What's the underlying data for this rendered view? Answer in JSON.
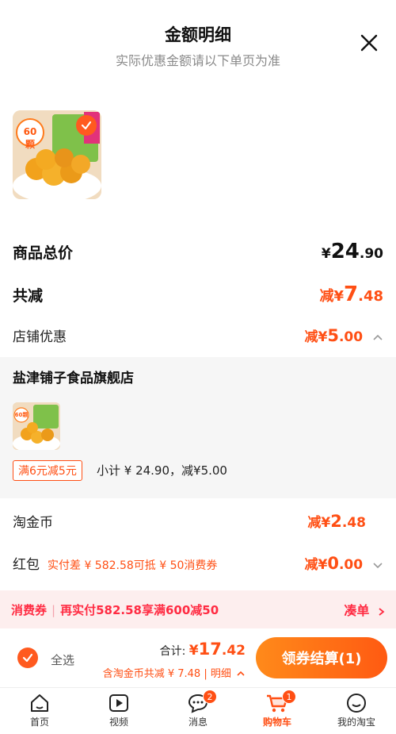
{
  "header": {
    "title": "金额明细",
    "subtitle": "实际优惠金额请以下单页为准"
  },
  "product": {
    "image_badge": "60颗"
  },
  "summary": {
    "total_label": "商品总价",
    "total_symbol": "¥",
    "total_int": "24",
    "total_dec": ".90",
    "reduce_label": "共减",
    "reduce_prefix": "减¥",
    "reduce_int": "7",
    "reduce_dec": ".48"
  },
  "store_discount": {
    "label": "店铺优惠",
    "prefix": "减¥",
    "int": "5",
    "dec": ".00"
  },
  "shop": {
    "name": "盐津铺子食品旗舰店",
    "thumb_badge": "60颗",
    "promo_tag": "满6元减5元",
    "subtotal": "小计 ¥ 24.90，减¥5.00"
  },
  "tao_coin": {
    "label": "淘金币",
    "prefix": "减¥",
    "int": "2",
    "dec": ".48"
  },
  "red_packet": {
    "label": "红包",
    "note": "实付差 ¥ 582.58可抵 ¥ 50消费券",
    "prefix": "减¥",
    "int": "0",
    "dec": ".00"
  },
  "coupon_bar": {
    "left_a": "消费券",
    "left_b": "再实付582.58享满600减50",
    "right": "凑单"
  },
  "checkout": {
    "select_all": "全选",
    "total_prefix": "合计:",
    "total_symbol": "¥",
    "total_int": "17",
    "total_dec": ".42",
    "sub": "含淘金币共减 ¥ 7.48 | 明细",
    "button": "领券结算(1)"
  },
  "tabs": [
    {
      "label": "首页",
      "icon": "home-icon"
    },
    {
      "label": "视频",
      "icon": "video-icon"
    },
    {
      "label": "消息",
      "icon": "message-icon",
      "badge": "2"
    },
    {
      "label": "购物车",
      "icon": "cart-icon",
      "badge": "1",
      "active": true
    },
    {
      "label": "我的淘宝",
      "icon": "profile-icon"
    }
  ],
  "colors": {
    "accent": "#ff4f14",
    "coupon_text": "#ff2b42",
    "coupon_bg": "#fdeeee"
  }
}
